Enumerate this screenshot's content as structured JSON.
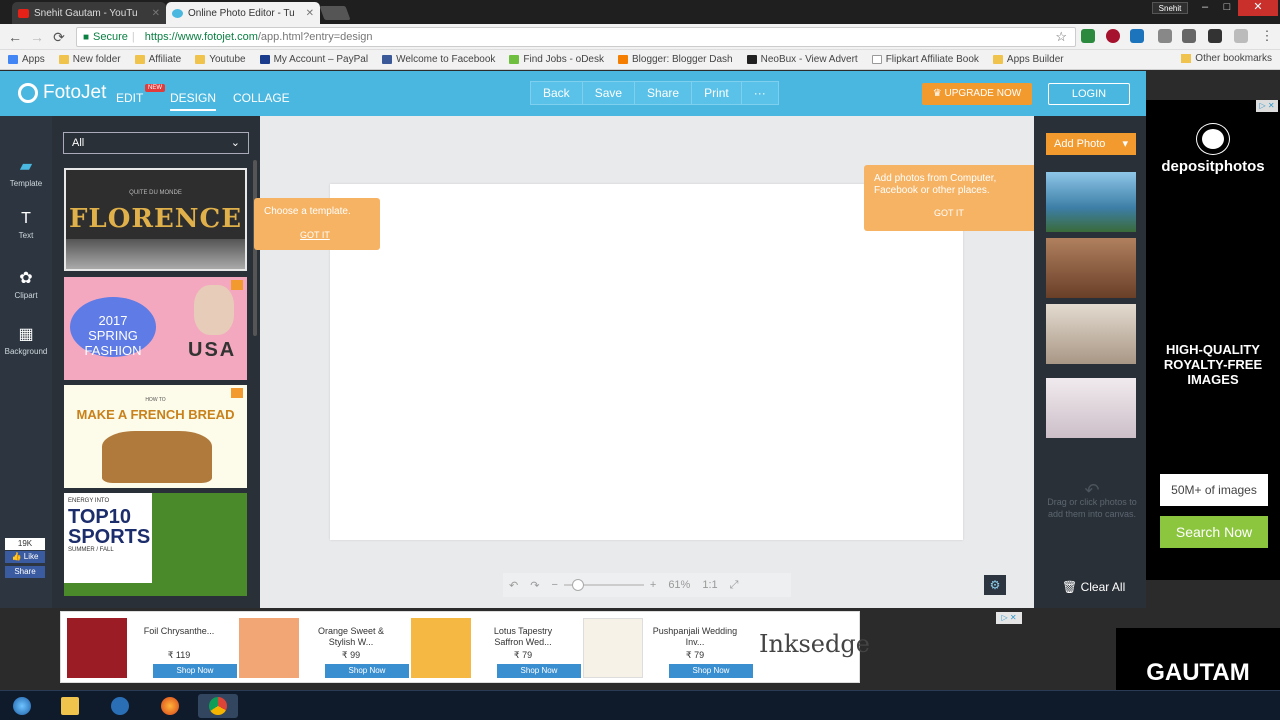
{
  "browser": {
    "tabs": [
      {
        "label": "Snehit Gautam - YouTu",
        "close": "✕"
      },
      {
        "label": "Online Photo Editor - Tu",
        "close": "✕"
      }
    ],
    "user_badge": "Snehit",
    "window_controls": [
      "–",
      "□",
      "✕"
    ],
    "secure_label": "Secure",
    "url_host": "https://www.fotojet.com",
    "url_path": "/app.html?entry=design",
    "nav": {
      "back": "←",
      "forward": "→",
      "reload": "⟳"
    },
    "star": "☆"
  },
  "bookmarks": {
    "items": [
      "Apps",
      "New folder",
      "Affiliate",
      "Youtube",
      "My Account – PayPal",
      "Welcome to Facebook",
      "Find Jobs - oDesk",
      "Blogger: Blogger Dash",
      "NeoBux - View Advert",
      "Flipkart Affiliate Book",
      "Apps Builder"
    ],
    "other": "Other bookmarks"
  },
  "app": {
    "logo": "FotoJet",
    "modes": {
      "edit": "EDIT",
      "new_badge": "NEW",
      "design": "DESIGN",
      "collage": "COLLAGE"
    },
    "actions": [
      "Back",
      "Save",
      "Share",
      "Print",
      "···"
    ],
    "upgrade": "♛ UPGRADE NOW",
    "login": "LOGIN"
  },
  "rail": {
    "tools": [
      {
        "label": "Template",
        "icon": "▰"
      },
      {
        "label": "Text",
        "icon": "T"
      },
      {
        "label": "Clipart",
        "icon": "✿"
      },
      {
        "label": "Background",
        "icon": "▦"
      }
    ],
    "facebook": {
      "count": "19K",
      "like": "👍 Like",
      "share": "Share"
    }
  },
  "templates": {
    "filter": "All",
    "chevron": "⌄",
    "items": [
      {
        "small": "QUITE DU MONDE",
        "title": "FLORENCE"
      },
      {
        "title": "2017 SPRING FASHION",
        "extra": "USA"
      },
      {
        "small": "HOW TO",
        "title": "MAKE A FRENCH BREAD"
      },
      {
        "small": "ENERGY INTO",
        "title": "TOP10 SPORTS",
        "sub": "SUMMER / FALL"
      }
    ]
  },
  "callouts": {
    "template": {
      "text": "Choose a template.",
      "gotit": "GOT IT"
    },
    "photo": {
      "text": "Add photos from Computer, Facebook or other places.",
      "gotit": "GOT IT"
    }
  },
  "canvas": {
    "zoom": {
      "undo": "↶",
      "redo": "↷",
      "minus": "−",
      "plus": "+",
      "percent": "61%",
      "ratio": "1:1",
      "fit": "⤢"
    },
    "settings": "⚙"
  },
  "photos": {
    "add": "Add Photo",
    "dropdown": "▾",
    "hint": "Drag or click photos to add them into canvas.",
    "arrow": "↶",
    "clear_icon": "🗑",
    "clear": "Clear All",
    "colors": [
      "#5a9ec8",
      "#8b5a3c",
      "#cbbfb0",
      "#e8dfe6"
    ]
  },
  "ad_right": {
    "brand": "depositphotos",
    "headline": "HIGH-QUALITY ROYALTY-FREE IMAGES",
    "count": "50M+ of images",
    "cta": "Search Now",
    "choices": "▷ ✕"
  },
  "ad_bottom": {
    "items": [
      {
        "name": "Foil Chrysanthe...",
        "price": "₹ 119",
        "shop": "Shop Now",
        "color": "#9b1c24"
      },
      {
        "name": "Orange Sweet & Stylish W...",
        "price": "₹ 99",
        "shop": "Shop Now",
        "color": "#f2a676"
      },
      {
        "name": "Lotus Tapestry Saffron Wed...",
        "price": "₹ 79",
        "shop": "Shop Now",
        "color": "#f4b843"
      },
      {
        "name": "Pushpanjali Wedding Inv...",
        "price": "₹ 79",
        "shop": "Shop Now",
        "color": "#f7f2e8"
      }
    ],
    "brand": "Inksedge",
    "choices": "▷ ✕"
  },
  "watermark": "GAUTAM"
}
